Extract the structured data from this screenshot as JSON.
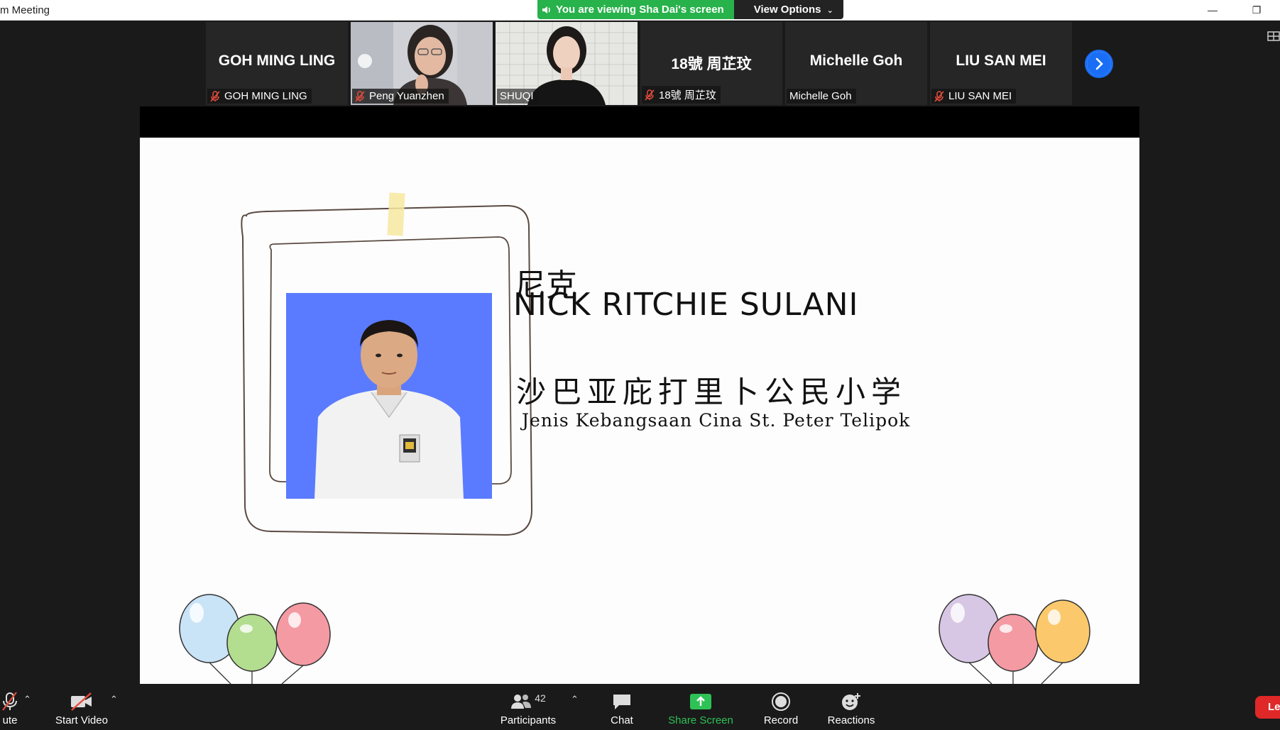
{
  "window": {
    "title": "m Meeting",
    "minimize_glyph": "—",
    "restore_glyph": "❐"
  },
  "banner": {
    "viewing_text": "You are viewing Sha Dai's screen",
    "view_options_label": "View Options"
  },
  "participants_strip": [
    {
      "big_name": "GOH MING LING",
      "label": "GOH MING LING",
      "muted": true,
      "video": false
    },
    {
      "big_name": "",
      "label": "Peng Yuanzhen",
      "muted": true,
      "video": true
    },
    {
      "big_name": "",
      "label": "SHUQI",
      "muted": false,
      "video": true,
      "active": true
    },
    {
      "big_name": "18號 周芷玟",
      "label": "18號 周芷玟",
      "muted": true,
      "video": false
    },
    {
      "big_name": "Michelle Goh",
      "label": "Michelle Goh",
      "muted": false,
      "video": false
    },
    {
      "big_name": "LIU SAN MEI",
      "label": "LIU SAN MEI",
      "muted": true,
      "video": false
    }
  ],
  "slide": {
    "name_cn": "尼克",
    "name_en": "NICK RITCHIE SULANI",
    "school_cn": "沙巴亚庇打里卜公民小学",
    "school_en": "Jenis Kebangsaan Cina St. Peter Telipok"
  },
  "toolbar": {
    "mute_label": "ute",
    "start_video_label": "Start Video",
    "participants_label": "Participants",
    "participants_count": "42",
    "chat_label": "Chat",
    "share_screen_label": "Share Screen",
    "record_label": "Record",
    "reactions_label": "Reactions",
    "leave_label": "Le"
  },
  "colors": {
    "banner_green": "#28b24b",
    "share_green": "#2ec155",
    "active_outline": "#9bcf3c",
    "next_blue": "#1a6ef5",
    "leave_red": "#e02828",
    "photo_bg": "#5a7bff"
  }
}
